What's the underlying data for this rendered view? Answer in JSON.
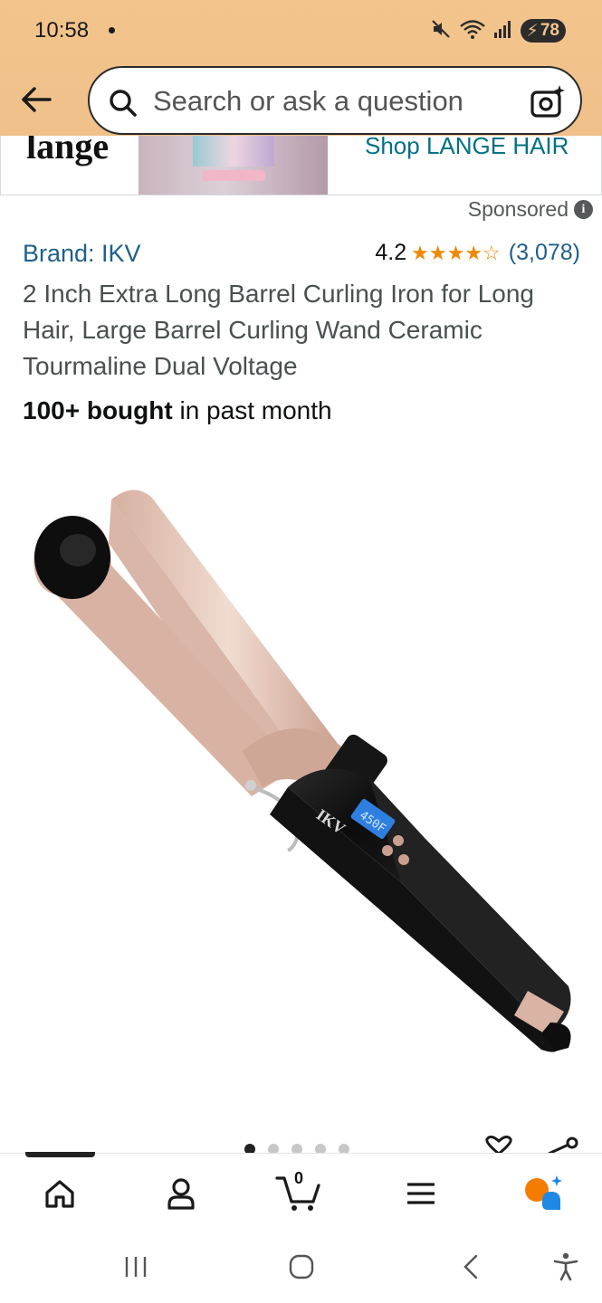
{
  "status_bar": {
    "time": "10:58",
    "battery": "78"
  },
  "search": {
    "placeholder": "Search or ask a question"
  },
  "banner": {
    "brand_text": "lange",
    "shop_link": "Shop LANGE HAIR"
  },
  "sponsored_label": "Sponsored",
  "product": {
    "brand": "Brand: IKV",
    "rating": "4.2",
    "stars_filled": 4,
    "stars_half": 1,
    "stars_display": "★★★★☆",
    "review_count": "(3,078)",
    "title": "2 Inch Extra Long Barrel Curling Iron for Long Hair, Large Barrel Curling Wand Ceramic Tourmaline Dual Voltage",
    "bought_bold": "100+ bought",
    "bought_rest": " in past month",
    "image_brand": "IKV",
    "image_display": "450F"
  },
  "carousel": {
    "total": 5,
    "active": 0
  },
  "bottom_nav": {
    "cart_count": "0"
  },
  "colors": {
    "header_bg": "#f3c58c",
    "link": "#1f5f8b",
    "star": "#f08804",
    "shop_link": "#007185"
  }
}
